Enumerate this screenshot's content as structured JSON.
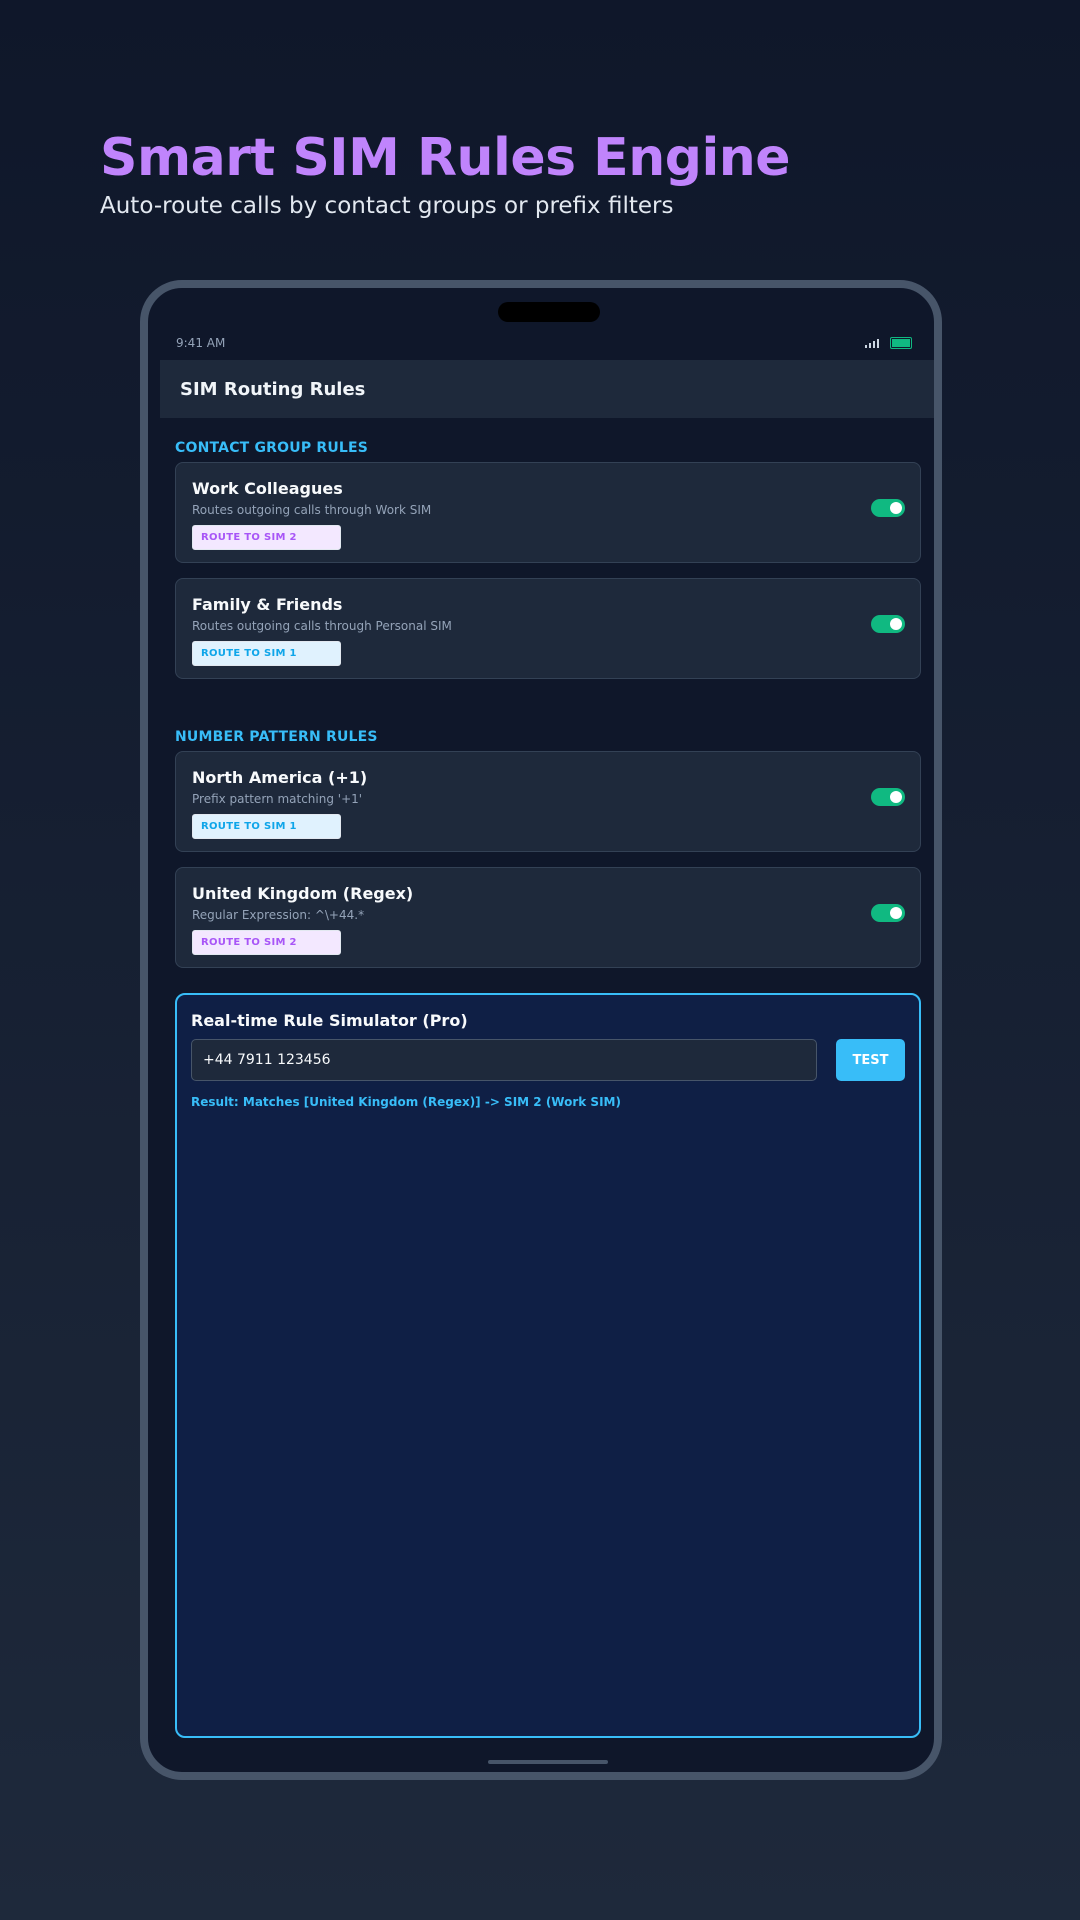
{
  "hero": {
    "title": "Smart SIM Rules Engine",
    "subtitle": "Auto-route calls by contact groups or prefix filters"
  },
  "status_bar": {
    "time": "9:41 AM"
  },
  "app_bar": {
    "title": "SIM Routing Rules"
  },
  "contact_group_section": {
    "title": "CONTACT GROUP RULES",
    "rules": [
      {
        "name": "Work Colleagues",
        "description": "Routes outgoing calls through Work SIM",
        "badge": "ROUTE TO SIM 2",
        "enabled": true
      },
      {
        "name": "Family & Friends",
        "description": "Routes outgoing calls through Personal SIM",
        "badge": "ROUTE TO SIM 1",
        "enabled": true
      }
    ]
  },
  "number_pattern_section": {
    "title": "NUMBER PATTERN RULES",
    "rules": [
      {
        "name": "North America (+1)",
        "description": "Prefix pattern matching '+1'",
        "badge": "ROUTE TO SIM 1",
        "enabled": true
      },
      {
        "name": "United Kingdom (Regex)",
        "description": "Regular Expression: ^\\+44.*",
        "badge": "ROUTE TO SIM 2",
        "enabled": true
      }
    ]
  },
  "simulator": {
    "title": "Real-time Rule Simulator (Pro)",
    "input_value": "+44 7911 123456",
    "button_label": "TEST",
    "result": "Result: Matches [United Kingdom (Regex)] -> SIM 2 (Work SIM)"
  },
  "colors": {
    "accent": "#38bdf8",
    "headline": "#c084fc",
    "toggle_on": "#10b981",
    "sim1": "#0ea5e9",
    "sim2": "#a855f7"
  }
}
